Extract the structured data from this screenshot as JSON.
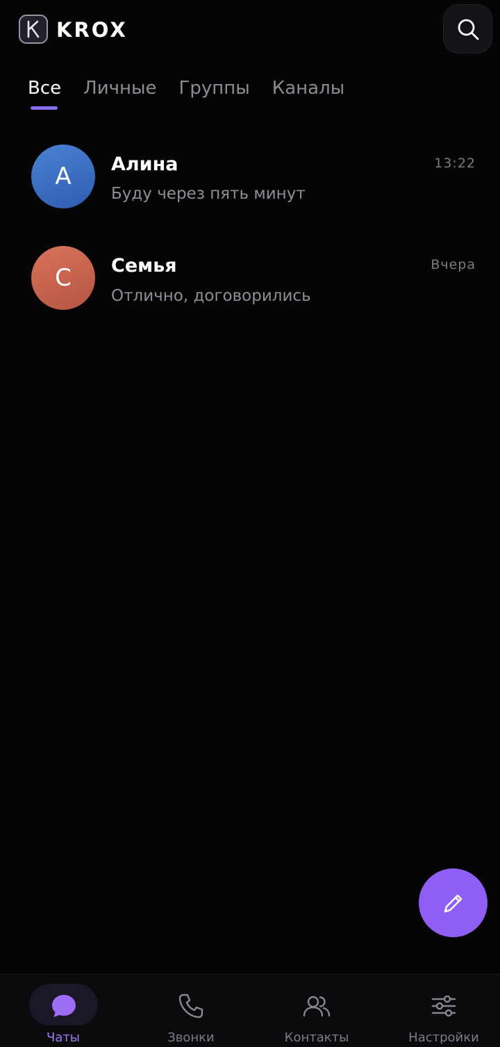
{
  "header": {
    "app_title": "KROX",
    "logo_letter": "K",
    "logo_icon": "k-logo-icon",
    "search_icon": "search-icon"
  },
  "tabs": [
    {
      "label": "Все",
      "active": true
    },
    {
      "label": "Личные",
      "active": false
    },
    {
      "label": "Группы",
      "active": false
    },
    {
      "label": "Каналы",
      "active": false
    }
  ],
  "chats": [
    {
      "initial": "А",
      "name": "Алина",
      "message": "Буду через пять минут",
      "time": "13:22",
      "avatar_color": "#3f74c8"
    },
    {
      "initial": "С",
      "name": "Семья",
      "message": "Отлично, договорились",
      "time": "Вчера",
      "avatar_color": "#cc6650"
    }
  ],
  "fab": {
    "icon": "pencil-icon",
    "color": "#8e5ff2"
  },
  "bottom_nav": [
    {
      "label": "Чаты",
      "icon": "chat-bubble-icon",
      "active": true
    },
    {
      "label": "Звонки",
      "icon": "phone-icon",
      "active": false
    },
    {
      "label": "Контакты",
      "icon": "contacts-icon",
      "active": false
    },
    {
      "label": "Настройки",
      "icon": "sliders-icon",
      "active": false
    }
  ],
  "colors": {
    "accent": "#8e5ff2",
    "background": "#050505",
    "active_label": "#9d7bf5"
  }
}
